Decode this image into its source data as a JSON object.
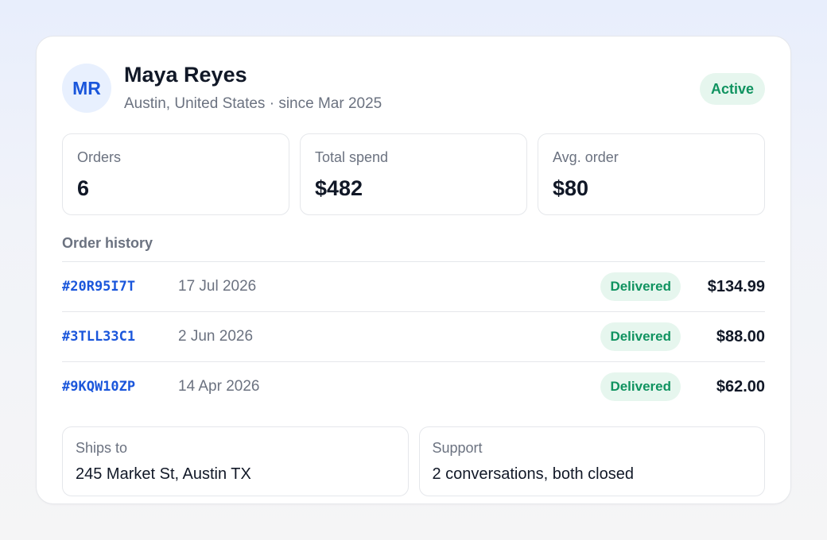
{
  "customer": {
    "initials": "MR",
    "name": "Maya Reyes",
    "subline": "Austin, United States · since Mar 2025",
    "status": "Active"
  },
  "stats": [
    {
      "label": "Orders",
      "value": "6"
    },
    {
      "label": "Total spend",
      "value": "$482"
    },
    {
      "label": "Avg. order",
      "value": "$80"
    }
  ],
  "order_history": {
    "title": "Order history",
    "rows": [
      {
        "id": "#20R95I7T",
        "date": "17 Jul 2026",
        "status": "Delivered",
        "amount": "$134.99"
      },
      {
        "id": "#3TLL33C1",
        "date": "2 Jun 2026",
        "status": "Delivered",
        "amount": "$88.00"
      },
      {
        "id": "#9KQW10ZP",
        "date": "14 Apr 2026",
        "status": "Delivered",
        "amount": "$62.00"
      }
    ]
  },
  "info": [
    {
      "label": "Ships to",
      "value": "245 Market St, Austin TX"
    },
    {
      "label": "Support",
      "value": "2 conversations, both closed"
    }
  ],
  "colors": {
    "accent": "#1a56db",
    "success": "#109360",
    "success_bg": "#e6f6ee"
  }
}
